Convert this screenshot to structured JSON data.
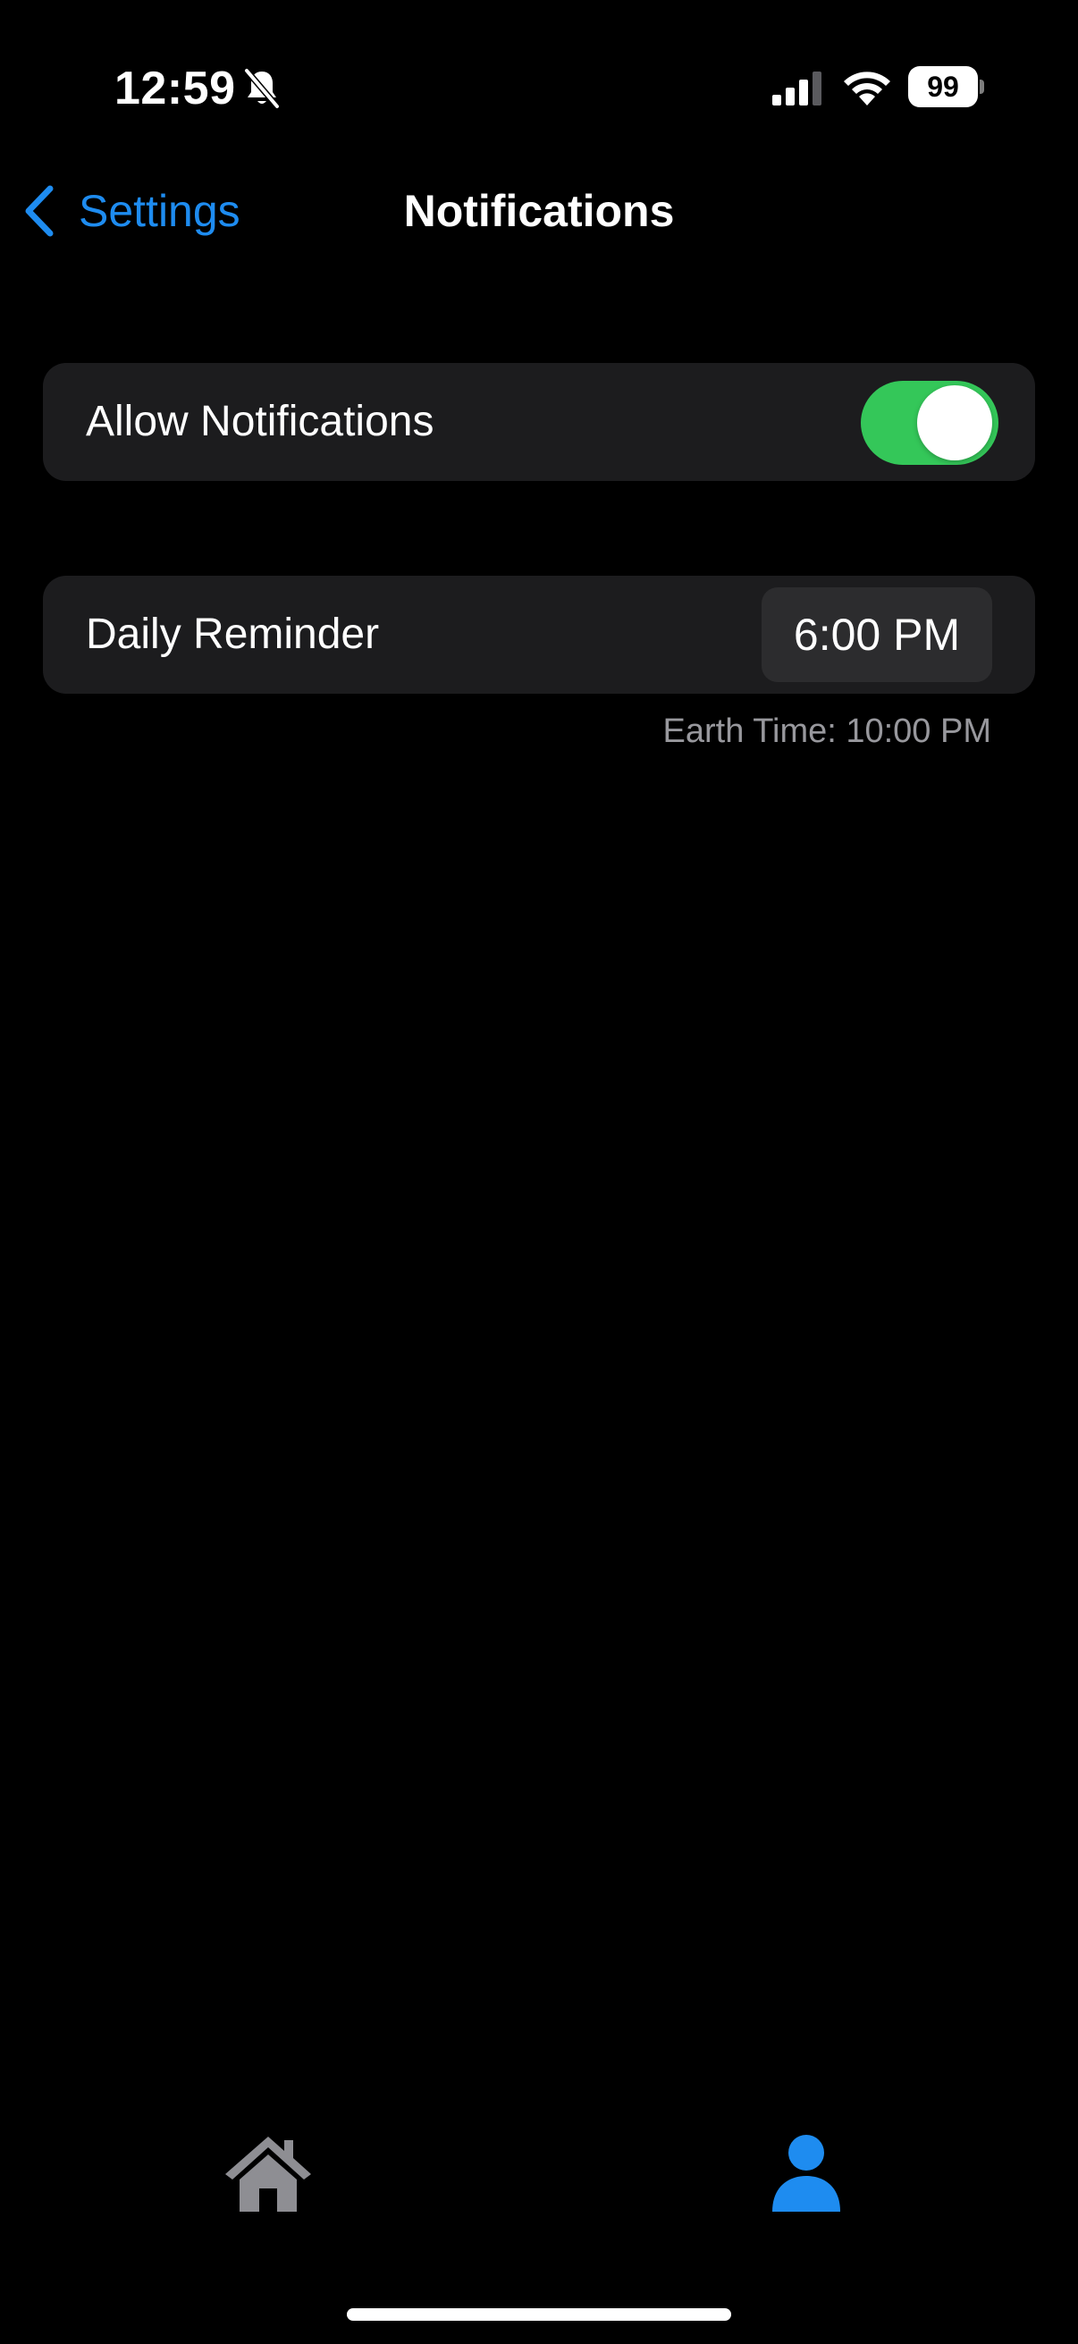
{
  "status_bar": {
    "time": "12:59",
    "battery_level": "99",
    "icons": [
      "bell-slash-icon",
      "cellular-signal-icon",
      "wifi-icon",
      "battery-icon"
    ]
  },
  "nav": {
    "back_label": "Settings",
    "title": "Notifications"
  },
  "notifications": {
    "allow_label": "Allow Notifications",
    "allow_enabled": true,
    "toggle_color": "#34c759"
  },
  "reminder": {
    "label": "Daily Reminder",
    "time_value": "6:00 PM",
    "earth_time": "Earth Time: 10:00 PM"
  },
  "tab_bar": {
    "tabs": [
      {
        "icon": "house-icon",
        "selected": false
      },
      {
        "icon": "person-icon",
        "selected": true
      }
    ],
    "selected_color": "#1e8cf0",
    "unselected_color": "#8e8e93"
  },
  "colors": {
    "accent": "#1e8cf0",
    "background": "#000000",
    "card": "#1c1c1e",
    "secondary_text": "#98989d"
  }
}
